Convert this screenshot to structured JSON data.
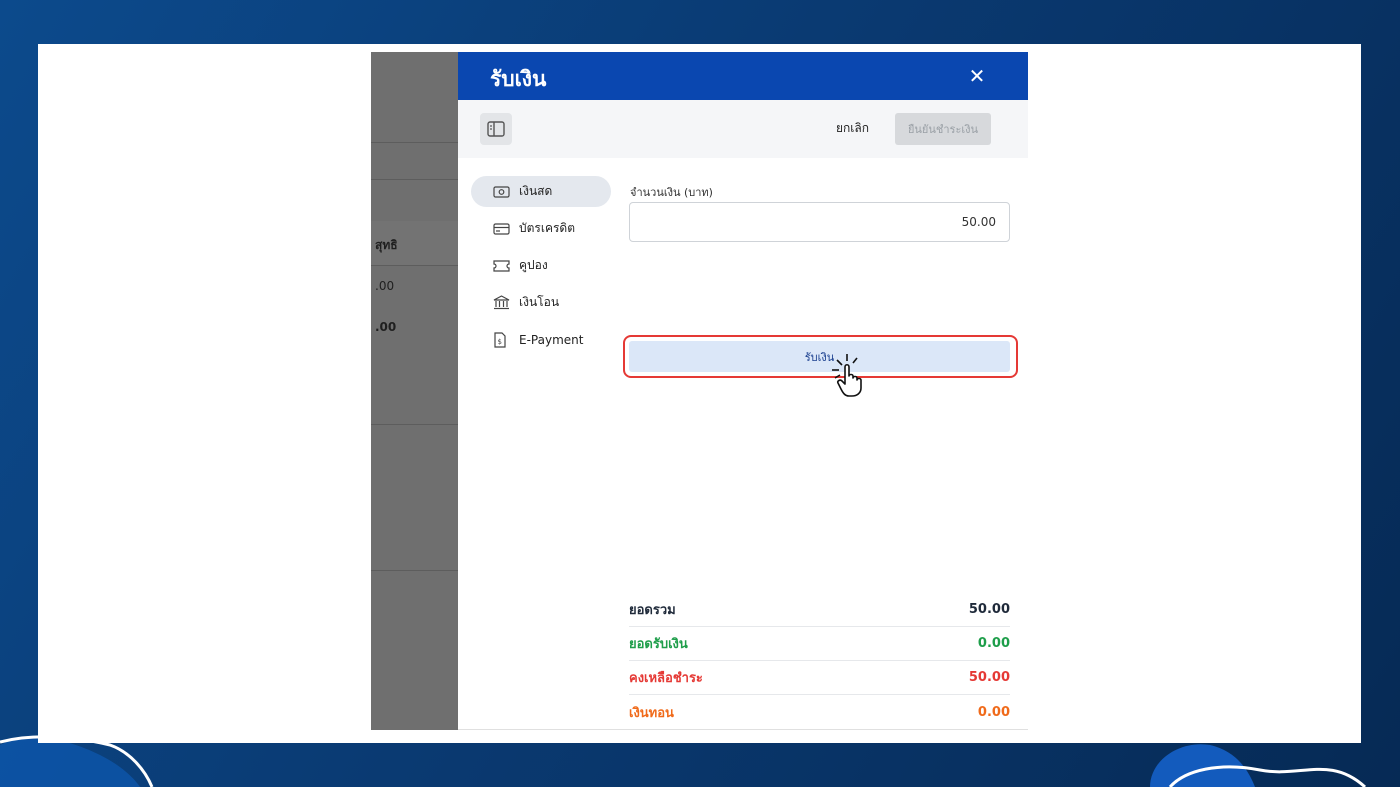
{
  "background_app": {
    "col_header": "สุทธิ",
    "value_1": ".00",
    "value_2": ".00"
  },
  "drawer": {
    "title": "รับเงิน",
    "close_icon": "close-icon",
    "header_color": "#0a47b0"
  },
  "toolbar": {
    "cancel_label": "ยกเลิก",
    "confirm_label": "ยืนยันชำระเงิน"
  },
  "payment_methods": [
    {
      "label": "เงินสด",
      "icon": "cash-icon",
      "active": true
    },
    {
      "label": "บัตรเครดิต",
      "icon": "credit-card-icon",
      "active": false
    },
    {
      "label": "คูปอง",
      "icon": "coupon-icon",
      "active": false
    },
    {
      "label": "เงินโอน",
      "icon": "bank-icon",
      "active": false
    },
    {
      "label": "E-Payment",
      "icon": "e-payment-icon",
      "active": false
    }
  ],
  "amount": {
    "label": "จำนวนเงิน (บาท)",
    "value": "50.00"
  },
  "receive_button_label": "รับเงิน",
  "summary": [
    {
      "label": "ยอดรวม",
      "value": "50.00",
      "color": "#1f2a3a"
    },
    {
      "label": "ยอดรับเงิน",
      "value": "0.00",
      "color": "#1e9e4a"
    },
    {
      "label": "คงเหลือชำระ",
      "value": "50.00",
      "color": "#e53935"
    },
    {
      "label": "เงินทอน",
      "value": "0.00",
      "color": "#f06a1a"
    }
  ]
}
